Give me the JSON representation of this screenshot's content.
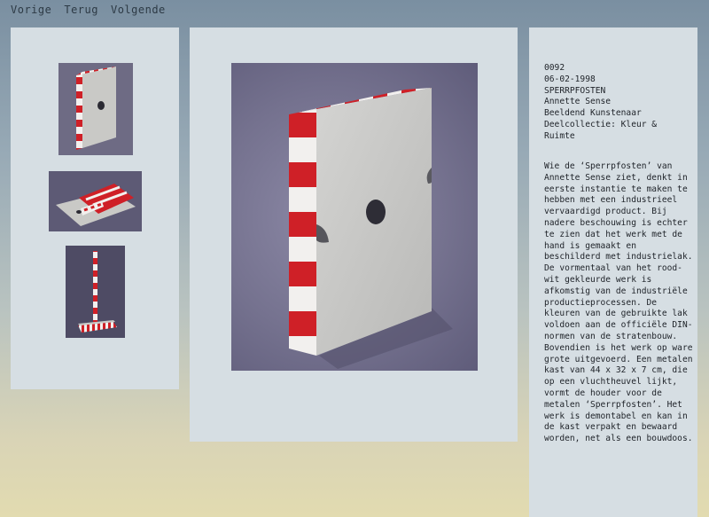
{
  "nav": {
    "prev_label": "Vorige",
    "back_label": "Terug",
    "next_label": "Volgende"
  },
  "artwork": {
    "number": "0092",
    "date": "06-02-1998",
    "title": "SPERRPFOSTEN",
    "artist": "Annette Sense",
    "role": "Beeldend Kunstenaar",
    "collection": "Deelcollectie: Kleur & Ruimte",
    "description": "Wie de ‘Sperrpfosten’ van Annette Sense ziet, denkt in eerste instantie te maken te hebben met een industrieel vervaardigd product. Bij nadere beschouwing is echter te zien dat het werk met de hand is gemaakt en beschilderd met industrielak. De vormentaal van het rood-wit gekleurde werk is afkomstig van de industriële productieprocessen. De kleuren van de gebruikte lak voldoen aan de officiële DIN-normen van de stratenbouw. Bovendien is het werk op ware grote uitgevoerd. Een metalen kast van 44 x 32 x 7 cm, die op een vluchtheuvel lijkt, vormt de houder voor de metalen ‘Sperrpfosten’. Het werk is demontabel en kan in de kast verpakt en bewaard worden, net als een bouwdoos."
  },
  "colors": {
    "stripe_red": "#cf2027",
    "stripe_white": "#f2f0ee",
    "box_grey": "#c9c9c6"
  }
}
